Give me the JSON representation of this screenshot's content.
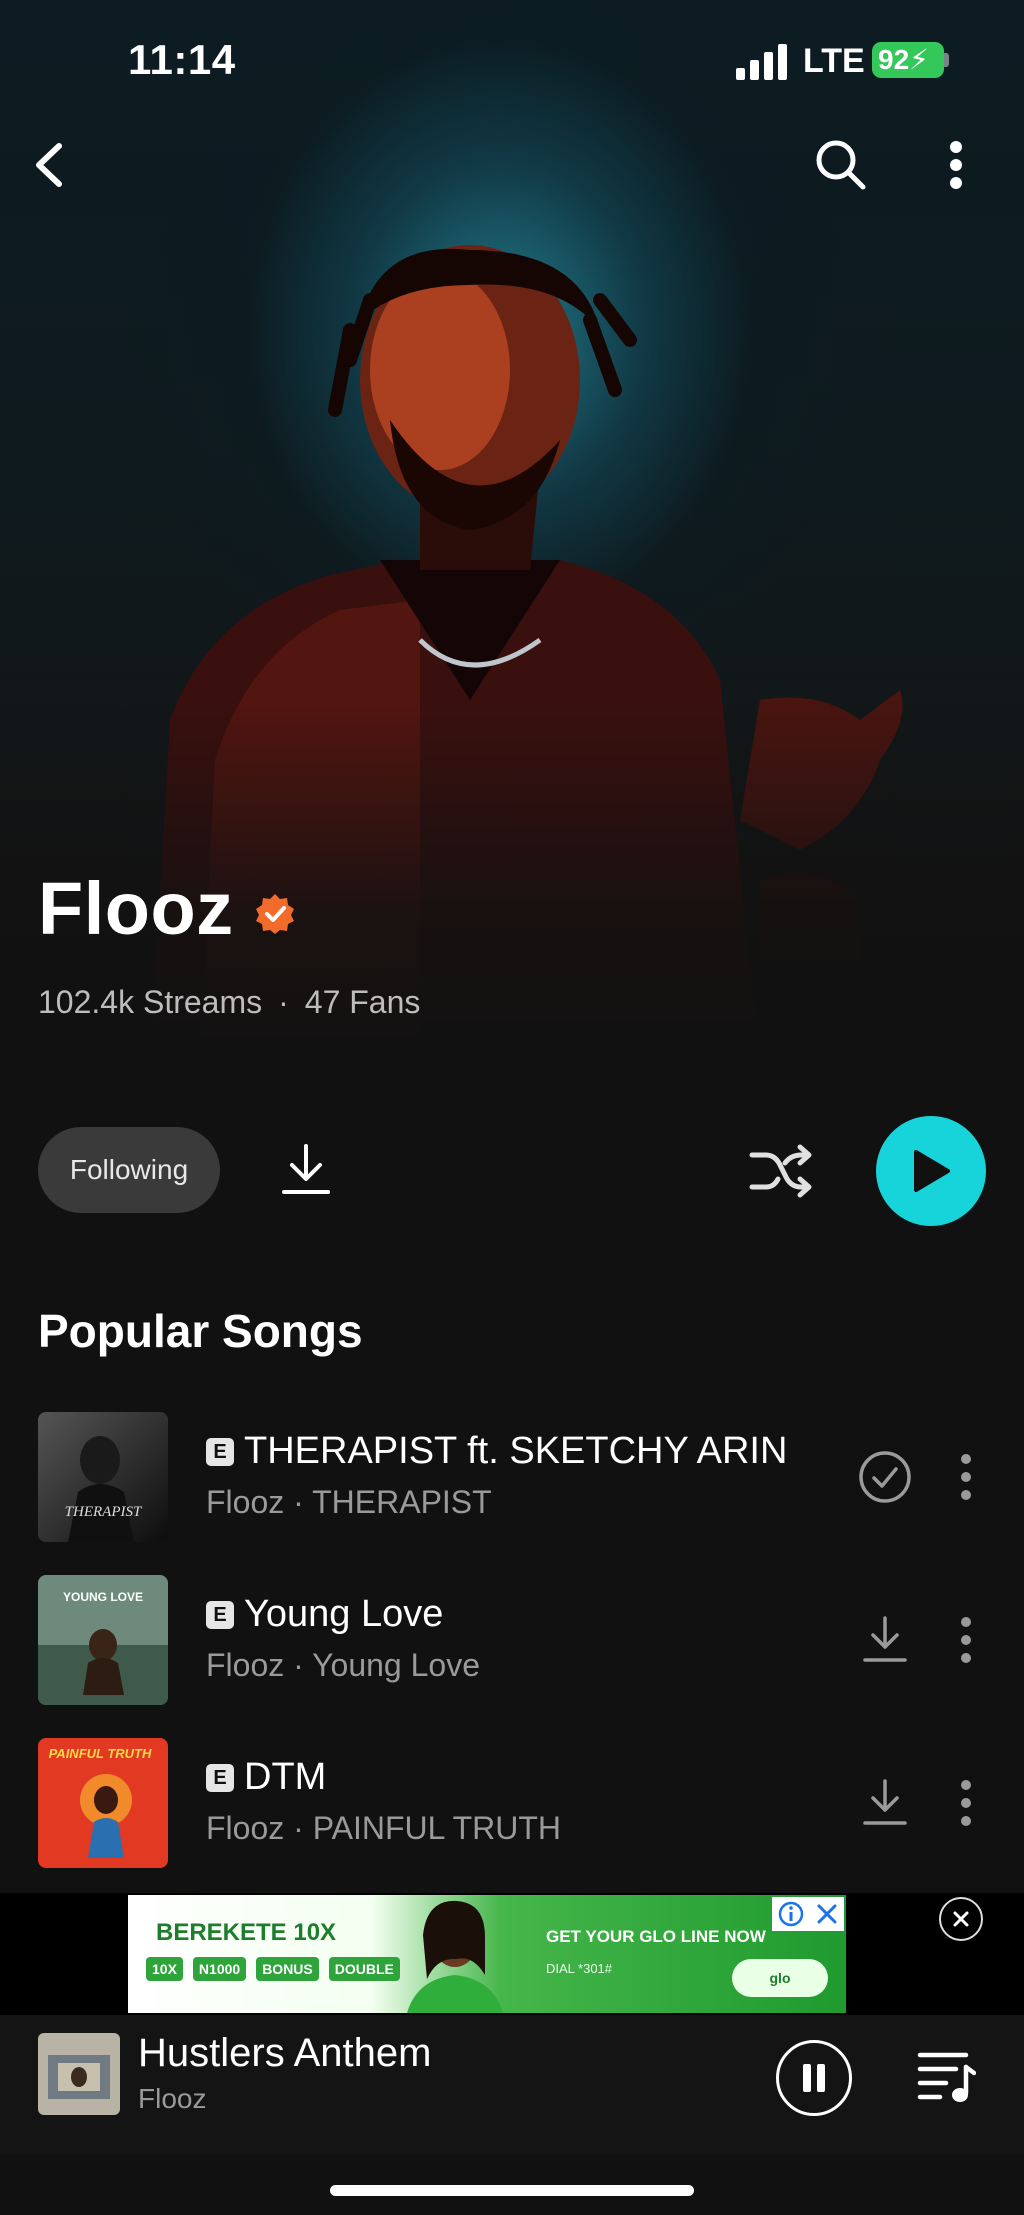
{
  "status_bar": {
    "time": "11:14",
    "network": "LTE",
    "battery": "92"
  },
  "nav": {
    "back_icon": "chevron-left-icon",
    "search_icon": "search-icon",
    "more_icon": "more-vertical-icon"
  },
  "artist": {
    "name": "Flooz",
    "streams": "102.4k Streams",
    "separator": "·",
    "fans": "47 Fans",
    "verified": true,
    "accent": "#f26b2b"
  },
  "actions": {
    "following_label": "Following",
    "play_color": "#17d4da"
  },
  "popular": {
    "title": "Popular Songs",
    "songs": [
      {
        "badge": "E",
        "title": "THERAPIST ft. SKETCHY ARIN",
        "subtitle": "Flooz · THERAPIST",
        "state": "downloaded",
        "art_text": "THERAPIST"
      },
      {
        "badge": "E",
        "title": "Young Love",
        "subtitle": "Flooz · Young Love",
        "state": "download",
        "art_text": "YOUNG LOVE"
      },
      {
        "badge": "E",
        "title": "DTM",
        "subtitle": "Flooz · PAINFUL TRUTH",
        "state": "download",
        "art_text": "PAINFUL TRUTH"
      }
    ]
  },
  "ad": {
    "headline": "BEREKETE 10X",
    "pills": [
      "10X",
      "N1000",
      "BONUS",
      "DOUBLE"
    ],
    "cta": "GET YOUR GLO LINE NOW",
    "dial": "DIAL *301#",
    "logo": "glo"
  },
  "now_playing": {
    "title": "Hustlers Anthem",
    "artist": "Flooz"
  }
}
